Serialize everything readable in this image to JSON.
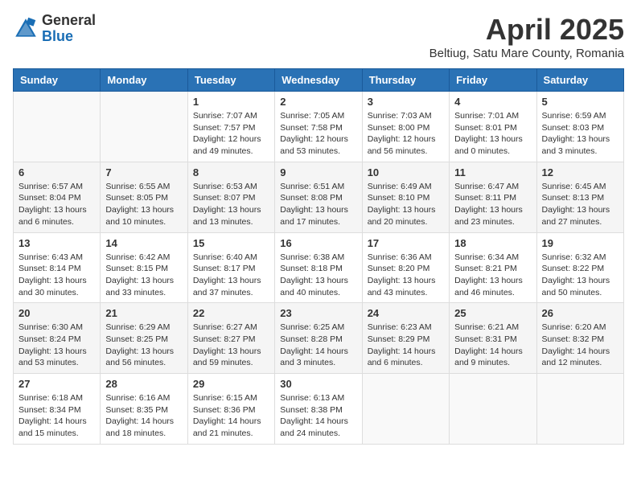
{
  "logo": {
    "line1": "General",
    "line2": "Blue"
  },
  "title": "April 2025",
  "location": "Beltiug, Satu Mare County, Romania",
  "days_of_week": [
    "Sunday",
    "Monday",
    "Tuesday",
    "Wednesday",
    "Thursday",
    "Friday",
    "Saturday"
  ],
  "weeks": [
    [
      {
        "day": "",
        "info": ""
      },
      {
        "day": "",
        "info": ""
      },
      {
        "day": "1",
        "info": "Sunrise: 7:07 AM\nSunset: 7:57 PM\nDaylight: 12 hours and 49 minutes."
      },
      {
        "day": "2",
        "info": "Sunrise: 7:05 AM\nSunset: 7:58 PM\nDaylight: 12 hours and 53 minutes."
      },
      {
        "day": "3",
        "info": "Sunrise: 7:03 AM\nSunset: 8:00 PM\nDaylight: 12 hours and 56 minutes."
      },
      {
        "day": "4",
        "info": "Sunrise: 7:01 AM\nSunset: 8:01 PM\nDaylight: 13 hours and 0 minutes."
      },
      {
        "day": "5",
        "info": "Sunrise: 6:59 AM\nSunset: 8:03 PM\nDaylight: 13 hours and 3 minutes."
      }
    ],
    [
      {
        "day": "6",
        "info": "Sunrise: 6:57 AM\nSunset: 8:04 PM\nDaylight: 13 hours and 6 minutes."
      },
      {
        "day": "7",
        "info": "Sunrise: 6:55 AM\nSunset: 8:05 PM\nDaylight: 13 hours and 10 minutes."
      },
      {
        "day": "8",
        "info": "Sunrise: 6:53 AM\nSunset: 8:07 PM\nDaylight: 13 hours and 13 minutes."
      },
      {
        "day": "9",
        "info": "Sunrise: 6:51 AM\nSunset: 8:08 PM\nDaylight: 13 hours and 17 minutes."
      },
      {
        "day": "10",
        "info": "Sunrise: 6:49 AM\nSunset: 8:10 PM\nDaylight: 13 hours and 20 minutes."
      },
      {
        "day": "11",
        "info": "Sunrise: 6:47 AM\nSunset: 8:11 PM\nDaylight: 13 hours and 23 minutes."
      },
      {
        "day": "12",
        "info": "Sunrise: 6:45 AM\nSunset: 8:13 PM\nDaylight: 13 hours and 27 minutes."
      }
    ],
    [
      {
        "day": "13",
        "info": "Sunrise: 6:43 AM\nSunset: 8:14 PM\nDaylight: 13 hours and 30 minutes."
      },
      {
        "day": "14",
        "info": "Sunrise: 6:42 AM\nSunset: 8:15 PM\nDaylight: 13 hours and 33 minutes."
      },
      {
        "day": "15",
        "info": "Sunrise: 6:40 AM\nSunset: 8:17 PM\nDaylight: 13 hours and 37 minutes."
      },
      {
        "day": "16",
        "info": "Sunrise: 6:38 AM\nSunset: 8:18 PM\nDaylight: 13 hours and 40 minutes."
      },
      {
        "day": "17",
        "info": "Sunrise: 6:36 AM\nSunset: 8:20 PM\nDaylight: 13 hours and 43 minutes."
      },
      {
        "day": "18",
        "info": "Sunrise: 6:34 AM\nSunset: 8:21 PM\nDaylight: 13 hours and 46 minutes."
      },
      {
        "day": "19",
        "info": "Sunrise: 6:32 AM\nSunset: 8:22 PM\nDaylight: 13 hours and 50 minutes."
      }
    ],
    [
      {
        "day": "20",
        "info": "Sunrise: 6:30 AM\nSunset: 8:24 PM\nDaylight: 13 hours and 53 minutes."
      },
      {
        "day": "21",
        "info": "Sunrise: 6:29 AM\nSunset: 8:25 PM\nDaylight: 13 hours and 56 minutes."
      },
      {
        "day": "22",
        "info": "Sunrise: 6:27 AM\nSunset: 8:27 PM\nDaylight: 13 hours and 59 minutes."
      },
      {
        "day": "23",
        "info": "Sunrise: 6:25 AM\nSunset: 8:28 PM\nDaylight: 14 hours and 3 minutes."
      },
      {
        "day": "24",
        "info": "Sunrise: 6:23 AM\nSunset: 8:29 PM\nDaylight: 14 hours and 6 minutes."
      },
      {
        "day": "25",
        "info": "Sunrise: 6:21 AM\nSunset: 8:31 PM\nDaylight: 14 hours and 9 minutes."
      },
      {
        "day": "26",
        "info": "Sunrise: 6:20 AM\nSunset: 8:32 PM\nDaylight: 14 hours and 12 minutes."
      }
    ],
    [
      {
        "day": "27",
        "info": "Sunrise: 6:18 AM\nSunset: 8:34 PM\nDaylight: 14 hours and 15 minutes."
      },
      {
        "day": "28",
        "info": "Sunrise: 6:16 AM\nSunset: 8:35 PM\nDaylight: 14 hours and 18 minutes."
      },
      {
        "day": "29",
        "info": "Sunrise: 6:15 AM\nSunset: 8:36 PM\nDaylight: 14 hours and 21 minutes."
      },
      {
        "day": "30",
        "info": "Sunrise: 6:13 AM\nSunset: 8:38 PM\nDaylight: 14 hours and 24 minutes."
      },
      {
        "day": "",
        "info": ""
      },
      {
        "day": "",
        "info": ""
      },
      {
        "day": "",
        "info": ""
      }
    ]
  ]
}
